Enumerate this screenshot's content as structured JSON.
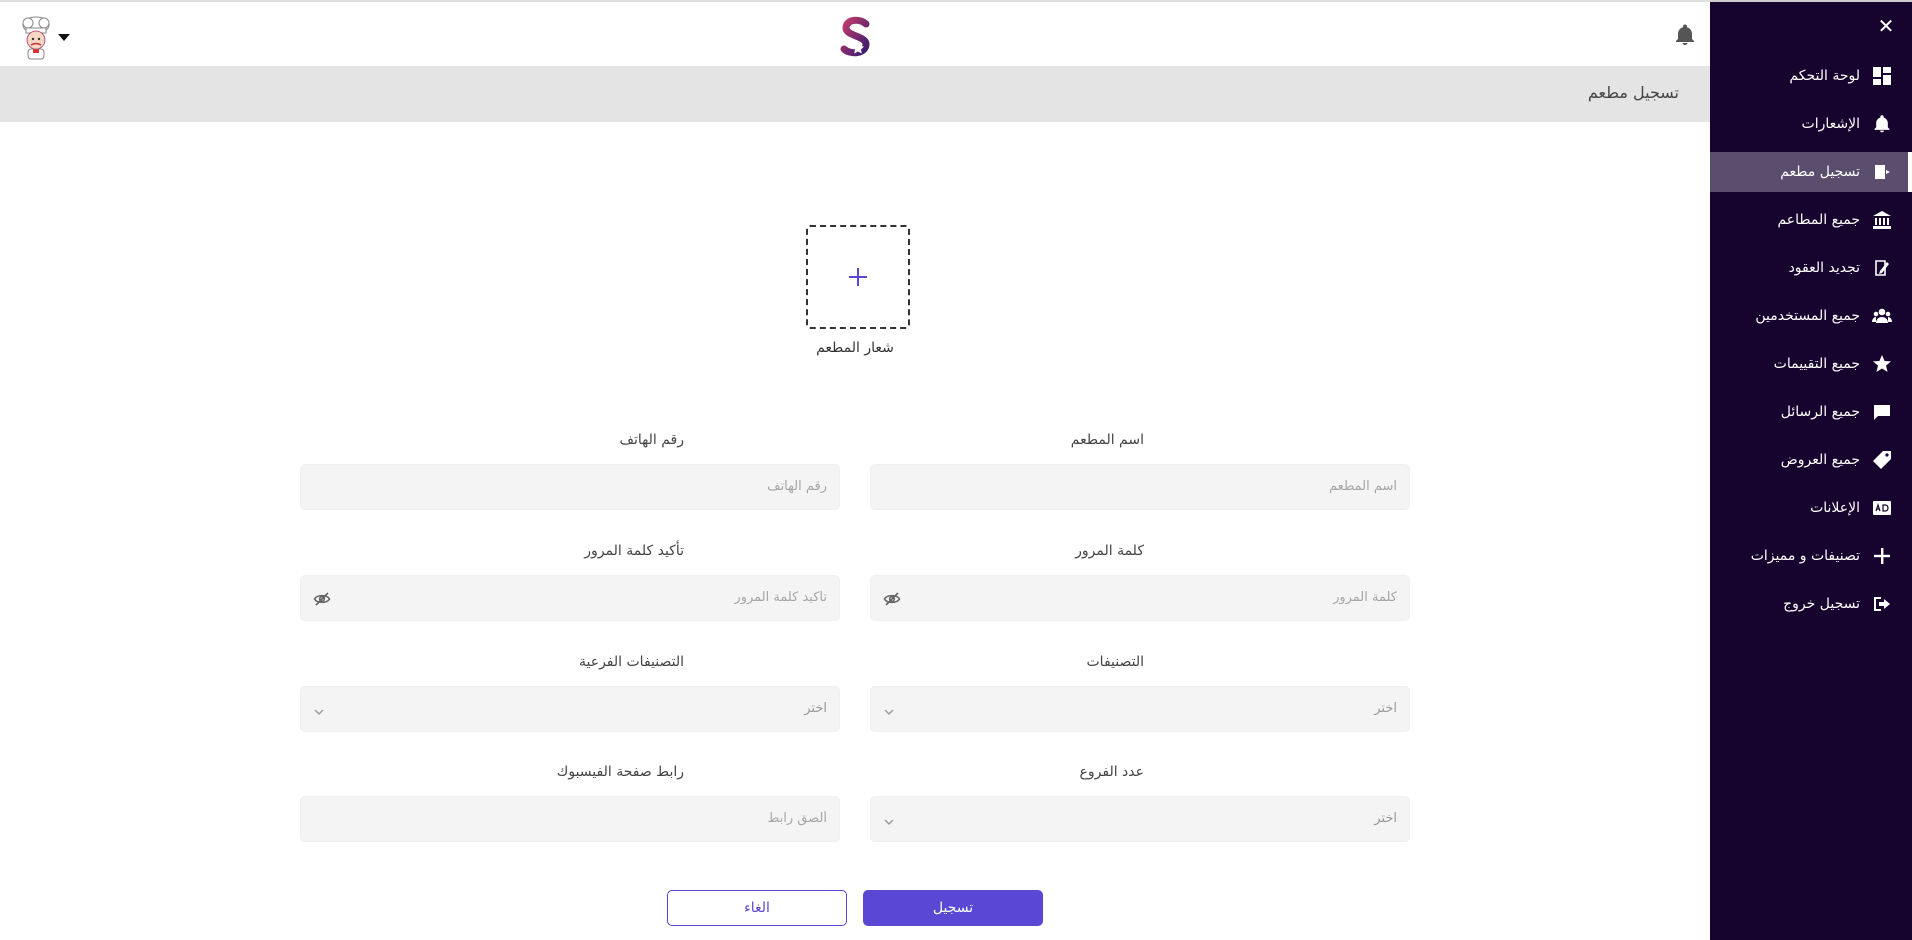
{
  "page": {
    "title": "تسجيل مطعم"
  },
  "sidebar": {
    "items": [
      {
        "label": "لوحة التحكم",
        "icon": "dashboard-icon"
      },
      {
        "label": "الإشعارات",
        "icon": "bell-icon"
      },
      {
        "label": "تسجيل مطعم",
        "icon": "register-icon",
        "active": true
      },
      {
        "label": "جميع المطاعم",
        "icon": "bank-icon"
      },
      {
        "label": "تجديد العقود",
        "icon": "edit-document-icon"
      },
      {
        "label": "جميع المستخدمين",
        "icon": "users-icon"
      },
      {
        "label": "جميع التقييمات",
        "icon": "star-icon"
      },
      {
        "label": "جميع الرسائل",
        "icon": "message-icon"
      },
      {
        "label": "جميع العروض",
        "icon": "tag-icon"
      },
      {
        "label": "الإعلانات",
        "icon": "ads-icon"
      },
      {
        "label": "تصنيفات و مميزات",
        "icon": "plus-icon"
      },
      {
        "label": "تسجيل خروج",
        "icon": "logout-icon"
      }
    ]
  },
  "upload": {
    "label": "شعار المطعم"
  },
  "form": {
    "restaurant_name": {
      "label": "اسم المطعم",
      "placeholder": "اسم المطعم"
    },
    "phone": {
      "label": "رقم الهاتف",
      "placeholder": "رقم الهاتف"
    },
    "password": {
      "label": "كلمة المرور",
      "placeholder": "كلمة المرور"
    },
    "confirm_password": {
      "label": "تأكيد كلمة المرور",
      "placeholder": "تأكيد كلمة المرور"
    },
    "categories": {
      "label": "التصنيفات",
      "placeholder": "اختر"
    },
    "subcategories": {
      "label": "التصنيفات الفرعية",
      "placeholder": "اختر"
    },
    "branches": {
      "label": "عدد الفروع",
      "placeholder": "اختر"
    },
    "facebook": {
      "label": "رابط صفحة الفيسبوك",
      "placeholder": "ألصق رابط"
    }
  },
  "buttons": {
    "submit": "تسجيل",
    "cancel": "الغاء"
  },
  "colors": {
    "sidebar_bg": "#16032e",
    "accent": "#5a47d4",
    "title_bar": "#e4e4e4"
  }
}
